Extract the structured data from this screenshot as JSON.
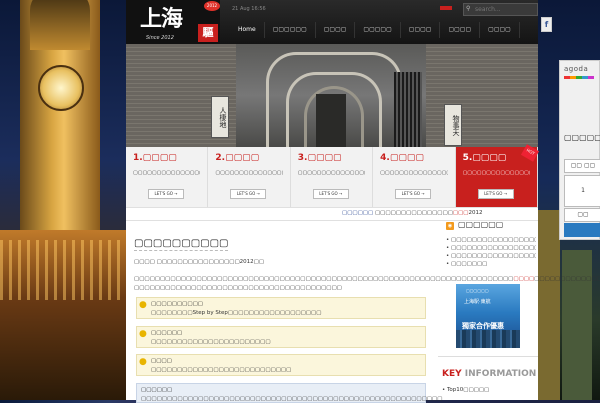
{
  "header": {
    "logo_text": "上海",
    "logo_badge": "2012",
    "logo_since": "Since 2012",
    "logo_red": "驅",
    "date": "21 Aug 16:56",
    "search_placeholder": "search..."
  },
  "nav": {
    "items": [
      "Home",
      "▢▢▢▢▢▢",
      "▢▢▢▢",
      "▢▢▢▢▢",
      "▢▢▢▢",
      "▢▢▢▢",
      "▢▢▢▢"
    ]
  },
  "hero": {
    "plaque_left": "人棲地",
    "plaque_right": "物事天"
  },
  "features": [
    {
      "title": "1.▢▢▢▢",
      "desc": "▢▢▢▢▢▢▢▢▢▢▢▢▢▢▢▢▢▢▢▢▢▢▢▢",
      "button": "LET'S GO →"
    },
    {
      "title": "2.▢▢▢▢",
      "desc": "▢▢▢▢▢▢▢▢▢▢▢▢▢▢▢▢▢▢▢▢...",
      "button": "LET'S GO →"
    },
    {
      "title": "3.▢▢▢▢",
      "desc": "▢▢▢▢▢▢▢▢▢▢▢▢▢▢▢▢▢▢▢▢▢",
      "button": "LET'S GO →"
    },
    {
      "title": "4.▢▢▢▢",
      "desc": "▢▢▢▢▢▢▢▢▢▢▢▢▢▢▢▢▢▢▢▢▢▢",
      "button": "LET'S GO →"
    },
    {
      "title": "5.▢▢▢▢",
      "desc": "▢▢▢▢▢▢▢▢▢▢▢▢▢▢▢▢▢▢▢▢▢▢",
      "button": "LET'S GO →",
      "tag": "HOT"
    }
  ],
  "ticker": {
    "part1": "▢▢▢▢▢▢ ",
    "part2": "▢▢▢▢▢▢▢▢▢▢▢▢▢▢▢",
    "part3": "▢▢▢",
    "part4": "2012"
  },
  "content": {
    "title": "▢▢▢▢▢▢▢▢▢▢",
    "subtitle": "▢▢▢▢ ▢▢▢▢▢▢▢▢▢▢▢▢▢▢▢▢2012▢▢",
    "para1": "▢▢▢▢▢▢▢▢▢▢▢▢▢▢▢▢▢▢▢▢▢▢▢▢▢▢▢▢▢▢▢▢▢▢▢▢▢▢▢▢▢▢▢▢▢▢▢▢▢▢▢▢▢▢▢▢▢▢▢▢▢▢▢▢▢▢▢▢▢▢▢▢▢",
    "para1_red": "▢▢▢▢",
    "para1_end": "▢▢▢▢▢▢▢▢▢▢▢▢▢▢▢▢▢",
    "para2": "▢▢▢▢▢▢▢▢▢▢▢▢▢▢▢▢▢▢▢▢▢▢▢▢▢▢▢▢▢▢▢▢▢▢▢▢▢▢▢▢",
    "tips": [
      {
        "title": "▢▢▢▢▢▢▢▢▢▢",
        "desc": "▢▢▢▢▢▢▢▢Step by Step▢▢▢▢▢▢▢▢▢▢▢▢▢▢▢▢▢▢"
      },
      {
        "title": "▢▢▢▢▢▢",
        "desc": "▢▢▢▢▢▢▢▢▢▢▢▢▢▢▢▢▢▢▢▢▢▢▢"
      },
      {
        "title": "▢▢▢▢",
        "desc": "▢▢▢▢▢▢▢▢▢▢▢▢▢▢▢▢▢▢▢▢▢▢▢▢▢▢▢"
      }
    ],
    "note_title": "▢▢▢▢▢▢",
    "note_desc": "▢▢▢▢▢▢▢▢▢▢▢▢▢▢▢▢▢▢▢▢▢▢▢▢▢▢▢▢▢▢▢▢▢▢▢▢▢▢▢▢▢▢▢▢▢▢▢▢▢▢▢▢▢▢▢▢▢▢"
  },
  "sidebar": {
    "title": "▢▢▢▢▢▢",
    "items": [
      {
        "text": "▢▢▢▢▢▢▢▢▢▢▢▢▢▢▢▢▢▢▢▢▢▢",
        "red": ""
      },
      {
        "text": "▢▢▢▢▢▢▢▢▢▢▢▢▢▢▢▢▢▢▢",
        "red": "▢▢"
      },
      {
        "text": "▢▢▢▢▢▢▢▢▢▢▢▢▢▢▢▢▢▢▢",
        "red": "▢▢▢"
      },
      {
        "text": "▢▢▢▢▢▢▢",
        "red": ""
      }
    ],
    "ad": {
      "logo": "▢▢▢▢▢▢",
      "line1": "上海駅·東航",
      "line2": "獨家合作優惠"
    },
    "key_word1": "KEY",
    "key_word2": "INFORMATION",
    "key_item": "• Top10▢▢▢▢▢"
  },
  "agoda": {
    "logo": "agoda",
    "heading": "▢▢▢▢▢▢",
    "field1": "▢▢ ▢▢",
    "field2": "1",
    "field3": "▢▢"
  },
  "colors": {
    "accent": "#c8201e",
    "header_bg": "#1a1a1a",
    "feature_bg": "#f2f2f2",
    "tip_bg": "#fbf6dc",
    "note_bg": "#e8eef6"
  }
}
